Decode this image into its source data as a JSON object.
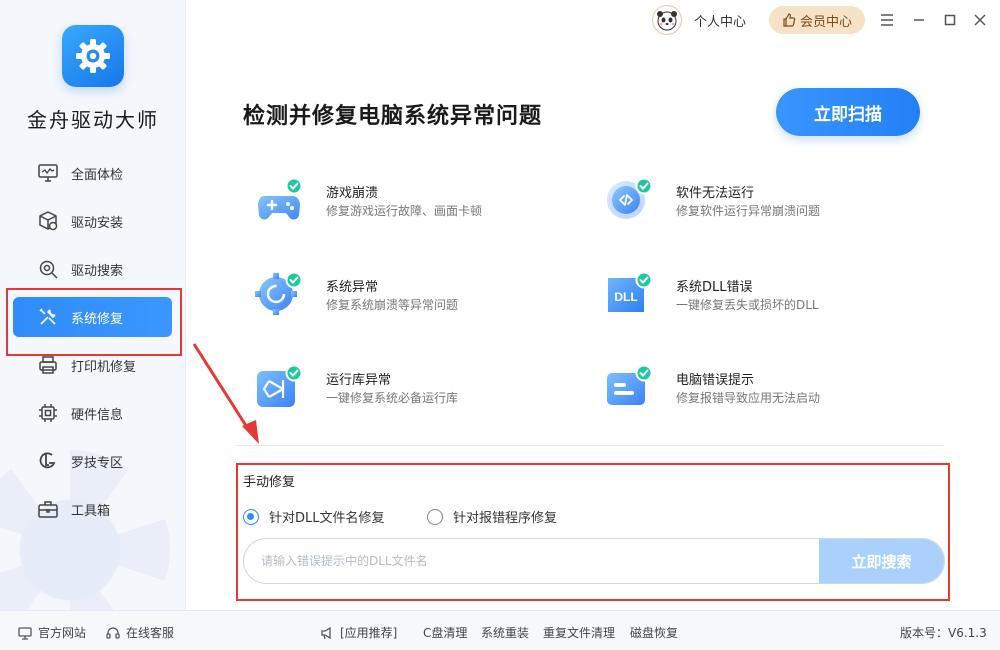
{
  "app": {
    "name": "金舟驱动大师"
  },
  "header": {
    "personal_label": "个人中心",
    "member_label": "会员中心"
  },
  "sidebar": {
    "items": [
      {
        "label": "全面体检",
        "icon": "monitor-icon"
      },
      {
        "label": "驱动安装",
        "icon": "package-icon"
      },
      {
        "label": "驱动搜索",
        "icon": "search-gear-icon"
      },
      {
        "label": "系统修复",
        "icon": "wrench-icon",
        "active": true
      },
      {
        "label": "打印机修复",
        "icon": "printer-icon"
      },
      {
        "label": "硬件信息",
        "icon": "chip-icon"
      },
      {
        "label": "罗技专区",
        "icon": "logitech-icon"
      },
      {
        "label": "工具箱",
        "icon": "toolbox-icon"
      }
    ]
  },
  "main": {
    "heading": "检测并修复电脑系统异常问题",
    "scan_button": "立即扫描",
    "cards": [
      {
        "title": "游戏崩溃",
        "desc": "修复游戏运行故障、画面卡顿",
        "icon": "gamepad-icon"
      },
      {
        "title": "软件无法运行",
        "desc": "修复软件运行异常崩溃问题",
        "icon": "code-icon"
      },
      {
        "title": "系统异常",
        "desc": "修复系统崩溃等异常问题",
        "icon": "system-gear-icon"
      },
      {
        "title": "系统DLL错误",
        "desc": "一键修复丢失或损坏的DLL",
        "icon": "dll-icon"
      },
      {
        "title": "运行库异常",
        "desc": "一键修复系统必备运行库",
        "icon": "runtime-icon"
      },
      {
        "title": "电脑错误提示",
        "desc": "修复报错导致应用无法启动",
        "icon": "error-card-icon"
      }
    ]
  },
  "manual": {
    "title": "手动修复",
    "option_dll": "针对DLL文件名修复",
    "option_program": "针对报错程序修复",
    "selected": "option_dll",
    "search_placeholder": "请输入错误提示中的DLL文件名",
    "search_button": "立即搜索"
  },
  "footer": {
    "website": "官方网站",
    "support": "在线客服",
    "recommend": "[应用推荐]",
    "links": [
      "C盘清理",
      "系统重装",
      "重复文件清理",
      "磁盘恢复"
    ],
    "version": "版本号：V6.1.3"
  },
  "colors": {
    "accent": "#2f8cf8",
    "member_bg": "#f6e3c7",
    "highlight_red": "#e53935",
    "check_green": "#1fc8a0"
  }
}
